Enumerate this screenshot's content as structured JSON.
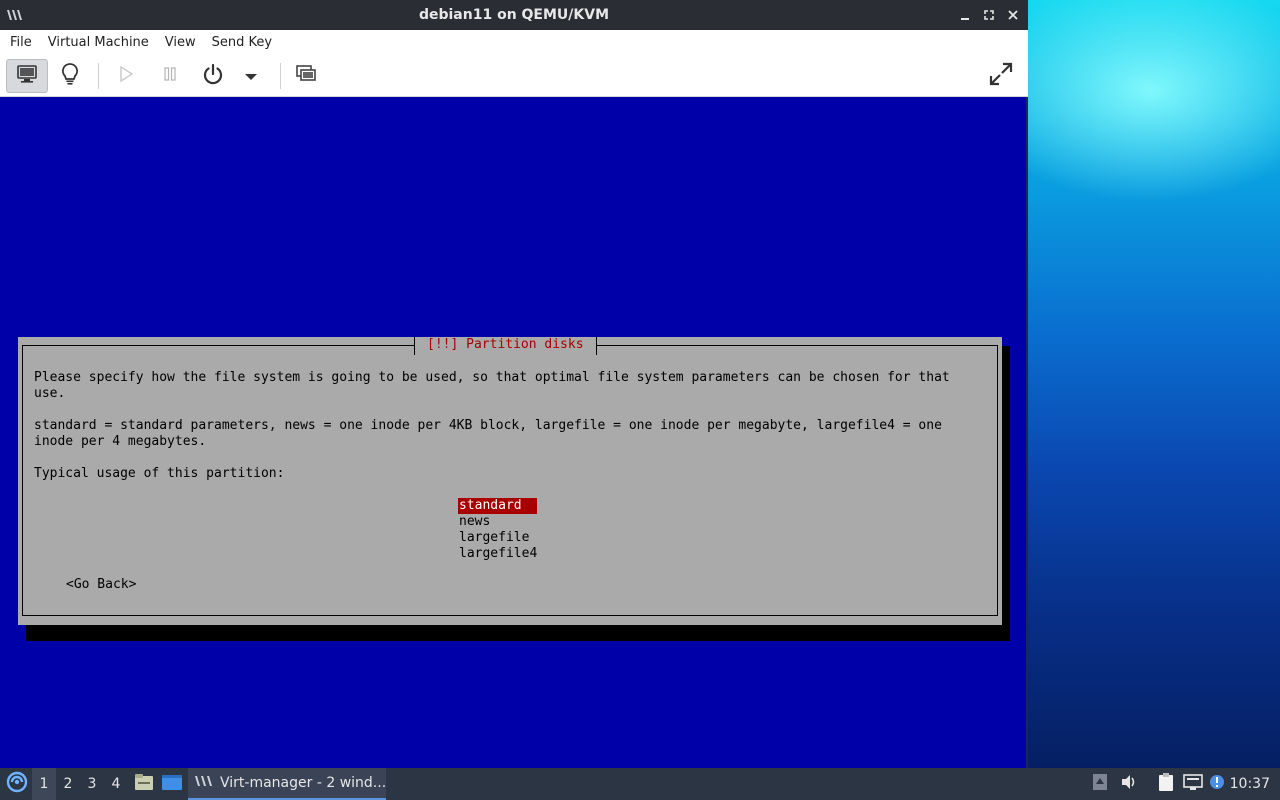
{
  "window": {
    "title": "debian11 on QEMU/KVM",
    "app_icon": "virt-manager-icon",
    "buttons": [
      "minimize-icon",
      "maximize-icon",
      "close-icon"
    ]
  },
  "menubar": {
    "items": [
      "File",
      "Virtual Machine",
      "View",
      "Send Key"
    ]
  },
  "toolbar": {
    "buttons": [
      {
        "name": "console-button",
        "icon": "monitor-icon",
        "active": true
      },
      {
        "name": "details-button",
        "icon": "lightbulb-icon",
        "active": false
      },
      {
        "name": "run-button",
        "icon": "play-icon",
        "active": false
      },
      {
        "name": "pause-button",
        "icon": "pause-icon",
        "active": false
      },
      {
        "name": "shutdown-button",
        "icon": "power-icon",
        "active": false
      },
      {
        "name": "shutdown-menu-button",
        "icon": "caret-down-icon",
        "active": false
      },
      {
        "name": "snapshots-button",
        "icon": "snapshots-icon",
        "active": false
      },
      {
        "name": "fullscreen-button",
        "icon": "fullscreen-icon",
        "active": false
      }
    ]
  },
  "dialog": {
    "title": "[!!] Partition disks",
    "paragraph1": "Please specify how the file system is going to be used, so that optimal file system parameters can be chosen for that use.",
    "paragraph2": "standard = standard parameters, news = one inode per 4KB block, largefile = one inode per megabyte, largefile4 = one inode per 4 megabytes.",
    "prompt": "Typical usage of this partition:",
    "options": [
      "standard",
      "news",
      "largefile",
      "largefile4"
    ],
    "selected_index": 0,
    "go_back": "<Go Back>"
  },
  "colors": {
    "console_bg": "#0000a8",
    "dialog_bg": "#aaaaaa",
    "dialog_title": "#a80000",
    "selection_bg": "#a80000"
  },
  "taskbar": {
    "start_icon": "start-menu-icon",
    "workspaces": [
      "1",
      "2",
      "3",
      "4"
    ],
    "active_workspace": "1",
    "launchers": [
      "file-manager-icon",
      "show-desktop-icon"
    ],
    "task": {
      "label": "Virt-manager - 2 wind...",
      "icon": "virt-manager-icon"
    },
    "tray": [
      "updates-icon",
      "volume-icon",
      "clipboard-icon",
      "network-icon",
      "notification-icon"
    ],
    "clock": "10:37"
  }
}
